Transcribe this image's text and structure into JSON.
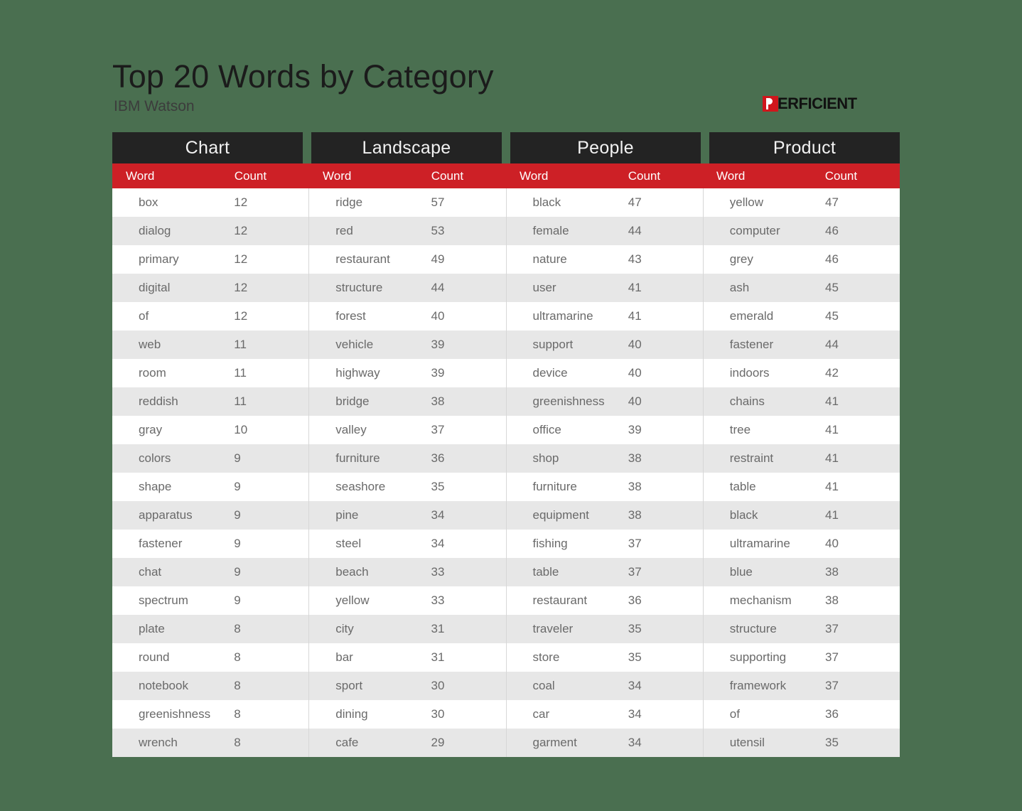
{
  "header": {
    "title": "Top 20 Words by Category",
    "subtitle": "IBM Watson"
  },
  "logo": {
    "mark": "perficient-p-mark",
    "text": "ERFICIENT",
    "full_name": "PERFICIENT",
    "mark_color": "#d0161c",
    "text_color": "#111111"
  },
  "colors": {
    "background": "#4a6f50",
    "category_header_bg": "#232323",
    "column_header_bg": "#cd2026",
    "row_alt_bg": "#e7e7e7",
    "row_bg": "#ffffff",
    "text": "#6a6a6a"
  },
  "table": {
    "column_headers": {
      "word": "Word",
      "count": "Count"
    },
    "categories": [
      {
        "name": "Chart",
        "rows": [
          {
            "word": "box",
            "count": 12
          },
          {
            "word": "dialog",
            "count": 12
          },
          {
            "word": "primary",
            "count": 12
          },
          {
            "word": "digital",
            "count": 12
          },
          {
            "word": "of",
            "count": 12
          },
          {
            "word": "web",
            "count": 11
          },
          {
            "word": "room",
            "count": 11
          },
          {
            "word": "reddish",
            "count": 11
          },
          {
            "word": "gray",
            "count": 10
          },
          {
            "word": "colors",
            "count": 9
          },
          {
            "word": "shape",
            "count": 9
          },
          {
            "word": "apparatus",
            "count": 9
          },
          {
            "word": "fastener",
            "count": 9
          },
          {
            "word": "chat",
            "count": 9
          },
          {
            "word": "spectrum",
            "count": 9
          },
          {
            "word": "plate",
            "count": 8
          },
          {
            "word": "round",
            "count": 8
          },
          {
            "word": "notebook",
            "count": 8
          },
          {
            "word": "greenishness",
            "count": 8
          },
          {
            "word": "wrench",
            "count": 8
          }
        ]
      },
      {
        "name": "Landscape",
        "rows": [
          {
            "word": "ridge",
            "count": 57
          },
          {
            "word": "red",
            "count": 53
          },
          {
            "word": "restaurant",
            "count": 49
          },
          {
            "word": "structure",
            "count": 44
          },
          {
            "word": "forest",
            "count": 40
          },
          {
            "word": "vehicle",
            "count": 39
          },
          {
            "word": "highway",
            "count": 39
          },
          {
            "word": "bridge",
            "count": 38
          },
          {
            "word": "valley",
            "count": 37
          },
          {
            "word": "furniture",
            "count": 36
          },
          {
            "word": "seashore",
            "count": 35
          },
          {
            "word": "pine",
            "count": 34
          },
          {
            "word": "steel",
            "count": 34
          },
          {
            "word": "beach",
            "count": 33
          },
          {
            "word": "yellow",
            "count": 33
          },
          {
            "word": "city",
            "count": 31
          },
          {
            "word": "bar",
            "count": 31
          },
          {
            "word": "sport",
            "count": 30
          },
          {
            "word": "dining",
            "count": 30
          },
          {
            "word": "cafe",
            "count": 29
          }
        ]
      },
      {
        "name": "People",
        "rows": [
          {
            "word": "black",
            "count": 47
          },
          {
            "word": "female",
            "count": 44
          },
          {
            "word": "nature",
            "count": 43
          },
          {
            "word": "user",
            "count": 41
          },
          {
            "word": "ultramarine",
            "count": 41
          },
          {
            "word": "support",
            "count": 40
          },
          {
            "word": "device",
            "count": 40
          },
          {
            "word": "greenishness",
            "count": 40
          },
          {
            "word": "office",
            "count": 39
          },
          {
            "word": "shop",
            "count": 38
          },
          {
            "word": "furniture",
            "count": 38
          },
          {
            "word": "equipment",
            "count": 38
          },
          {
            "word": "fishing",
            "count": 37
          },
          {
            "word": "table",
            "count": 37
          },
          {
            "word": "restaurant",
            "count": 36
          },
          {
            "word": "traveler",
            "count": 35
          },
          {
            "word": "store",
            "count": 35
          },
          {
            "word": "coal",
            "count": 34
          },
          {
            "word": "car",
            "count": 34
          },
          {
            "word": "garment",
            "count": 34
          }
        ]
      },
      {
        "name": "Product",
        "rows": [
          {
            "word": "yellow",
            "count": 47
          },
          {
            "word": "computer",
            "count": 46
          },
          {
            "word": "grey",
            "count": 46
          },
          {
            "word": "ash",
            "count": 45
          },
          {
            "word": "emerald",
            "count": 45
          },
          {
            "word": "fastener",
            "count": 44
          },
          {
            "word": "indoors",
            "count": 42
          },
          {
            "word": "chains",
            "count": 41
          },
          {
            "word": "tree",
            "count": 41
          },
          {
            "word": "restraint",
            "count": 41
          },
          {
            "word": "table",
            "count": 41
          },
          {
            "word": "black",
            "count": 41
          },
          {
            "word": "ultramarine",
            "count": 40
          },
          {
            "word": "blue",
            "count": 38
          },
          {
            "word": "mechanism",
            "count": 38
          },
          {
            "word": "structure",
            "count": 37
          },
          {
            "word": "supporting",
            "count": 37
          },
          {
            "word": "framework",
            "count": 37
          },
          {
            "word": "of",
            "count": 36
          },
          {
            "word": "utensil",
            "count": 35
          }
        ]
      }
    ]
  },
  "chart_data": {
    "type": "table",
    "title": "Top 20 Words by Category",
    "subtitle": "IBM Watson",
    "columns": [
      "Word",
      "Count"
    ],
    "groups": [
      "Chart",
      "Landscape",
      "People",
      "Product"
    ],
    "series": [
      {
        "name": "Chart",
        "categories": [
          "box",
          "dialog",
          "primary",
          "digital",
          "of",
          "web",
          "room",
          "reddish",
          "gray",
          "colors",
          "shape",
          "apparatus",
          "fastener",
          "chat",
          "spectrum",
          "plate",
          "round",
          "notebook",
          "greenishness",
          "wrench"
        ],
        "values": [
          12,
          12,
          12,
          12,
          12,
          11,
          11,
          11,
          10,
          9,
          9,
          9,
          9,
          9,
          9,
          8,
          8,
          8,
          8,
          8
        ]
      },
      {
        "name": "Landscape",
        "categories": [
          "ridge",
          "red",
          "restaurant",
          "structure",
          "forest",
          "vehicle",
          "highway",
          "bridge",
          "valley",
          "furniture",
          "seashore",
          "pine",
          "steel",
          "beach",
          "yellow",
          "city",
          "bar",
          "sport",
          "dining",
          "cafe"
        ],
        "values": [
          57,
          53,
          49,
          44,
          40,
          39,
          39,
          38,
          37,
          36,
          35,
          34,
          34,
          33,
          33,
          31,
          31,
          30,
          30,
          29
        ]
      },
      {
        "name": "People",
        "categories": [
          "black",
          "female",
          "nature",
          "user",
          "ultramarine",
          "support",
          "device",
          "greenishness",
          "office",
          "shop",
          "furniture",
          "equipment",
          "fishing",
          "table",
          "restaurant",
          "traveler",
          "store",
          "coal",
          "car",
          "garment"
        ],
        "values": [
          47,
          44,
          43,
          41,
          41,
          40,
          40,
          40,
          39,
          38,
          38,
          38,
          37,
          37,
          36,
          35,
          35,
          34,
          34,
          34
        ]
      },
      {
        "name": "Product",
        "categories": [
          "yellow",
          "computer",
          "grey",
          "ash",
          "emerald",
          "fastener",
          "indoors",
          "chains",
          "tree",
          "restraint",
          "table",
          "black",
          "ultramarine",
          "blue",
          "mechanism",
          "structure",
          "supporting",
          "framework",
          "of",
          "utensil"
        ],
        "values": [
          47,
          46,
          46,
          45,
          45,
          44,
          42,
          41,
          41,
          41,
          41,
          41,
          40,
          38,
          38,
          37,
          37,
          37,
          36,
          35
        ]
      }
    ]
  }
}
